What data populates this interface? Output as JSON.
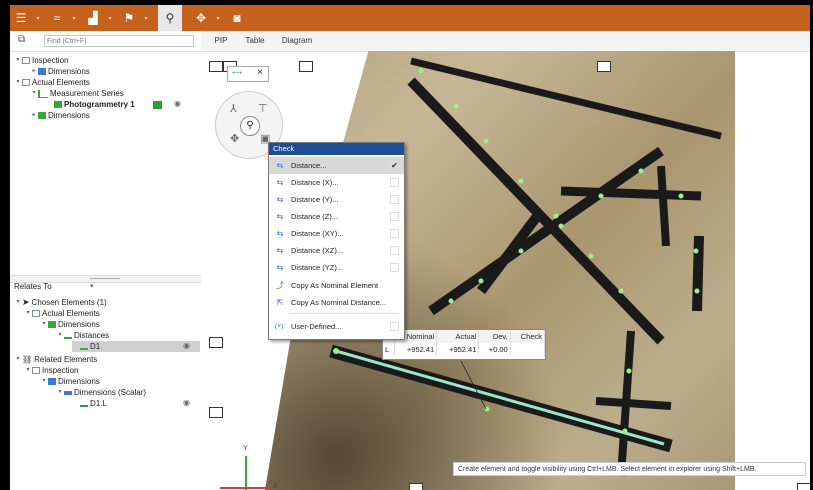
{
  "toolbar": {
    "menu_icon": "hamburger-icon",
    "items": [
      {
        "name": "graph-icon",
        "glyph": "≈"
      },
      {
        "name": "chart-icon",
        "glyph": "▟"
      },
      {
        "name": "flag-icon",
        "glyph": "⚑"
      },
      {
        "name": "search-icon",
        "glyph": "⚲"
      },
      {
        "name": "target-icon",
        "glyph": "✥"
      },
      {
        "name": "camera-icon",
        "glyph": "◙"
      }
    ],
    "caret": "▾"
  },
  "explorer": {
    "find_placeholder": "Find (Ctrl+F)",
    "tree": [
      {
        "label": "Inspection",
        "expand": "▾"
      },
      {
        "label": "Dimensions",
        "expand": "▸"
      },
      {
        "label": "Actual Elements",
        "expand": "▾"
      },
      {
        "label": "Measurement Series",
        "expand": "▾"
      },
      {
        "label": "Photogrammetry 1",
        "expand": ""
      },
      {
        "label": "Dimensions",
        "expand": "▸"
      }
    ]
  },
  "relates": {
    "title": "Relates To",
    "caret": "▾",
    "tree": [
      {
        "label": "Chosen Elements (1)",
        "expand": "▾"
      },
      {
        "label": "Actual Elements",
        "expand": "▾"
      },
      {
        "label": "Dimensions",
        "expand": "▾"
      },
      {
        "label": "Distances",
        "expand": "▾"
      },
      {
        "label": "D1",
        "expand": ""
      },
      {
        "label": "Related Elements",
        "expand": "▾"
      },
      {
        "label": "Inspection",
        "expand": "▾"
      },
      {
        "label": "Dimensions",
        "expand": "▾"
      },
      {
        "label": "Dimensions (Scalar)",
        "expand": "▾"
      },
      {
        "label": "D1.L",
        "expand": ""
      }
    ]
  },
  "view": {
    "tabs": [
      "PIP",
      "Table",
      "Diagram"
    ]
  },
  "check_menu": {
    "title": "Check",
    "items": [
      {
        "label": "Distance...",
        "icon": "⇆",
        "checked": "✔"
      },
      {
        "label": "Distance (X)...",
        "icon": "⇆",
        "checked": ""
      },
      {
        "label": "Distance (Y)...",
        "icon": "⇆",
        "checked": ""
      },
      {
        "label": "Distance (Z)...",
        "icon": "⇆",
        "checked": ""
      },
      {
        "label": "Distance (XY)...",
        "icon": "⇆",
        "checked": ""
      },
      {
        "label": "Distance (XZ)...",
        "icon": "⇆",
        "checked": ""
      },
      {
        "label": "Distance (YZ)...",
        "icon": "⇆",
        "checked": ""
      },
      {
        "label": "Copy As Nominal Element",
        "icon": "⤴",
        "checked": ""
      },
      {
        "label": "Copy As Nominal Distance...",
        "icon": "⇱",
        "checked": ""
      },
      {
        "label": "User-Defined...",
        "icon": "(×);",
        "checked": ""
      }
    ]
  },
  "label_table": {
    "headers": [
      "",
      "Nominal",
      "Actual",
      "Dev.",
      "Check"
    ],
    "row": [
      "L",
      "+952.41",
      "+952.41",
      "+0.00",
      ""
    ]
  },
  "status": "Create element and toggle visibility using Ctrl+LMB. Select element in explorer using Shift+LMB.",
  "axis": {
    "x": "X",
    "y": "Y"
  },
  "chip_close": "×",
  "compass_center": "⚲"
}
